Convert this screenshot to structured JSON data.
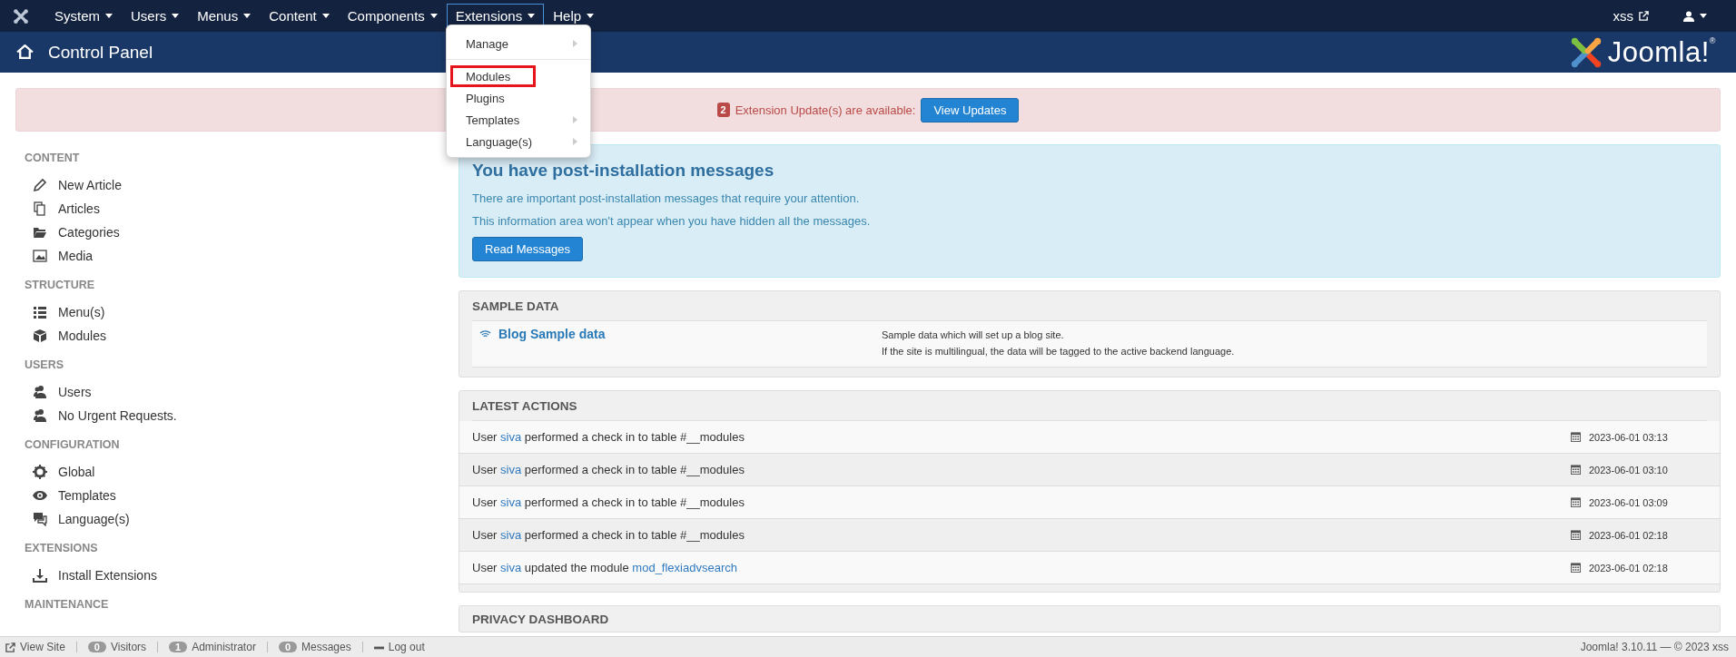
{
  "top_menu": {
    "items": [
      {
        "label": "System",
        "selected": false
      },
      {
        "label": "Users",
        "selected": false
      },
      {
        "label": "Menus",
        "selected": false
      },
      {
        "label": "Content",
        "selected": false
      },
      {
        "label": "Components",
        "selected": false
      },
      {
        "label": "Extensions",
        "selected": true
      },
      {
        "label": "Help",
        "selected": false
      }
    ],
    "site_link": "xss"
  },
  "extensions_menu": {
    "items": [
      {
        "label": "Manage",
        "submenu": true,
        "highlighted": false,
        "divider_after": true
      },
      {
        "label": "Modules",
        "submenu": false,
        "highlighted": true,
        "divider_after": false
      },
      {
        "label": "Plugins",
        "submenu": false,
        "highlighted": false,
        "divider_after": false
      },
      {
        "label": "Templates",
        "submenu": true,
        "highlighted": false,
        "divider_after": false
      },
      {
        "label": "Language(s)",
        "submenu": true,
        "highlighted": false,
        "divider_after": false
      }
    ]
  },
  "header": {
    "title": "Control Panel",
    "logo": "Joomla!$^{®}$"
  },
  "update_alert": {
    "count": "2",
    "text": "Extension Update(s) are available:",
    "button": "View Updates"
  },
  "sidebar": {
    "sections": [
      {
        "title": "CONTENT",
        "items": [
          {
            "label": "New Article",
            "kind": "pencil"
          },
          {
            "label": "Articles",
            "kind": "copy"
          },
          {
            "label": "Categories",
            "kind": "folder"
          },
          {
            "label": "Media",
            "kind": "image"
          }
        ]
      },
      {
        "title": "STRUCTURE",
        "items": [
          {
            "label": "Menu(s)",
            "kind": "list"
          },
          {
            "label": "Modules",
            "kind": "cube"
          }
        ]
      },
      {
        "title": "USERS",
        "items": [
          {
            "label": "Users",
            "kind": "users"
          },
          {
            "label": "No Urgent Requests.",
            "kind": "users"
          }
        ]
      },
      {
        "title": "CONFIGURATION",
        "items": [
          {
            "label": "Global",
            "kind": "gear"
          },
          {
            "label": "Templates",
            "kind": "eye"
          },
          {
            "label": "Language(s)",
            "kind": "comments"
          }
        ]
      },
      {
        "title": "EXTENSIONS",
        "items": [
          {
            "label": "Install Extensions",
            "kind": "download"
          }
        ]
      },
      {
        "title": "MAINTENANCE"
      }
    ]
  },
  "postinstall": {
    "title": "You have post-installation messages",
    "lines": [
      "There are important post-installation messages that require your attention.",
      "This information area won't appear when you have hidden all the messages."
    ],
    "button": "Read Messages"
  },
  "sample_data": {
    "title": "SAMPLE DATA",
    "items": [
      {
        "name": "Blog Sample data",
        "lines": [
          "Sample data which will set up a blog site.",
          "If the site is multilingual, the data will be tagged to the active backend language."
        ]
      }
    ]
  },
  "latest_actions": {
    "title": "LATEST ACTIONS",
    "rows": [
      {
        "segments": [
          {
            "text": "User ",
            "link": false
          },
          {
            "text": "siva",
            "link": true
          },
          {
            "text": " performed a check in to table #__modules",
            "link": false
          }
        ],
        "date": "2023-06-01 03:13"
      },
      {
        "segments": [
          {
            "text": "User ",
            "link": false
          },
          {
            "text": "siva",
            "link": true
          },
          {
            "text": " performed a check in to table #__modules",
            "link": false
          }
        ],
        "date": "2023-06-01 03:10"
      },
      {
        "segments": [
          {
            "text": "User ",
            "link": false
          },
          {
            "text": "siva",
            "link": true
          },
          {
            "text": " performed a check in to table #__modules",
            "link": false
          }
        ],
        "date": "2023-06-01 03:09"
      },
      {
        "segments": [
          {
            "text": "User ",
            "link": false
          },
          {
            "text": "siva",
            "link": true
          },
          {
            "text": " performed a check in to table #__modules",
            "link": false
          }
        ],
        "date": "2023-06-01 02:18"
      },
      {
        "segments": [
          {
            "text": "User ",
            "link": false
          },
          {
            "text": "siva",
            "link": true
          },
          {
            "text": " updated the module ",
            "link": false
          },
          {
            "text": "mod_flexiadvsearch",
            "link": true
          }
        ],
        "date": "2023-06-01 02:18"
      }
    ]
  },
  "privacy_dashboard": {
    "title": "PRIVACY DASHBOARD"
  },
  "status_bar": {
    "items": [
      {
        "kind": "link",
        "label": "View Site"
      },
      {
        "kind": "count",
        "count": "0",
        "label": "Visitors"
      },
      {
        "kind": "count",
        "count": "1",
        "label": "Administrator"
      },
      {
        "kind": "count",
        "count": "0",
        "label": "Messages"
      },
      {
        "kind": "logout",
        "label": "Log out"
      }
    ],
    "version": "Joomla! 3.10.11 — © 2023 xss"
  }
}
